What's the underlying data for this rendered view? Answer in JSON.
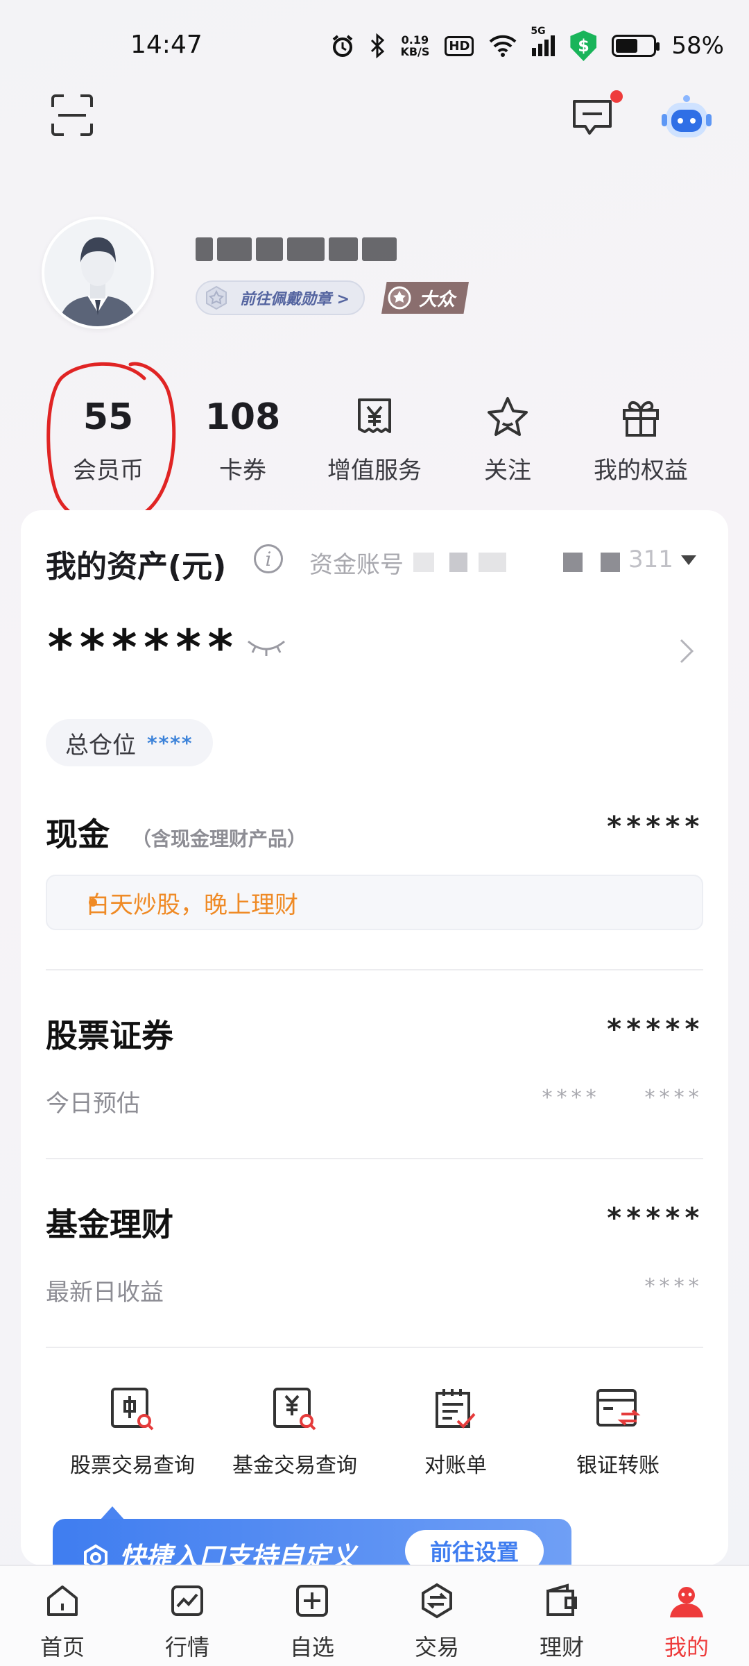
{
  "status_bar": {
    "time": "14:47",
    "net_speed_value": "0.19",
    "net_speed_unit": "KB/S",
    "hd": "HD",
    "signal": "5G",
    "battery": "58%",
    "battery_level": 0.58
  },
  "top_bar": {
    "scan_icon": "scan-icon",
    "message_icon": "message-icon",
    "assistant_icon": "robot-assistant-icon",
    "message_badge_color": "#ee3b3b"
  },
  "profile": {
    "medal_link": "前往佩戴勋章 >",
    "level_badge": "大众"
  },
  "stats": [
    {
      "value": "55",
      "label": "会员币"
    },
    {
      "value": "108",
      "label": "卡券"
    },
    {
      "icon": "yen-receipt-icon",
      "label": "增值服务"
    },
    {
      "icon": "star-icon",
      "label": "关注"
    },
    {
      "icon": "gift-icon",
      "label": "我的权益"
    }
  ],
  "assets": {
    "title": "我的资产(元)",
    "account_label": "资金账号",
    "account_suffix": "311",
    "total_masked": "******",
    "position_label": "总仓位",
    "position_masked": "****"
  },
  "cash": {
    "title": "现金",
    "subtitle": "（含现金理财产品）",
    "value_masked": "*****",
    "tip": "白天炒股，晚上理财"
  },
  "stocks": {
    "title": "股票证券",
    "value_masked": "*****",
    "row_label": "今日预估",
    "row_value_1": "****",
    "row_value_2": "****"
  },
  "funds": {
    "title": "基金理财",
    "value_masked": "*****",
    "row_label": "最新日收益",
    "row_value": "****"
  },
  "quick_entries": [
    {
      "icon": "stock-query-icon",
      "label": "股票交易查询"
    },
    {
      "icon": "fund-query-icon",
      "label": "基金交易查询"
    },
    {
      "icon": "statement-icon",
      "label": "对账单"
    },
    {
      "icon": "bank-transfer-icon",
      "label": "银证转账"
    }
  ],
  "banner": {
    "text": "快捷入口支持自定义",
    "button": "前往设置"
  },
  "bottom_nav": [
    {
      "label": "首页",
      "icon": "home-icon"
    },
    {
      "label": "行情",
      "icon": "market-chart-icon"
    },
    {
      "label": "自选",
      "icon": "add-box-icon"
    },
    {
      "label": "交易",
      "icon": "trade-exchange-icon"
    },
    {
      "label": "理财",
      "icon": "wallet-icon"
    },
    {
      "label": "我的",
      "icon": "profile-icon",
      "active": true
    }
  ],
  "colors": {
    "accent_red": "#ee3b3b",
    "accent_blue": "#3f7df0",
    "tip_orange": "#ef8a25"
  }
}
